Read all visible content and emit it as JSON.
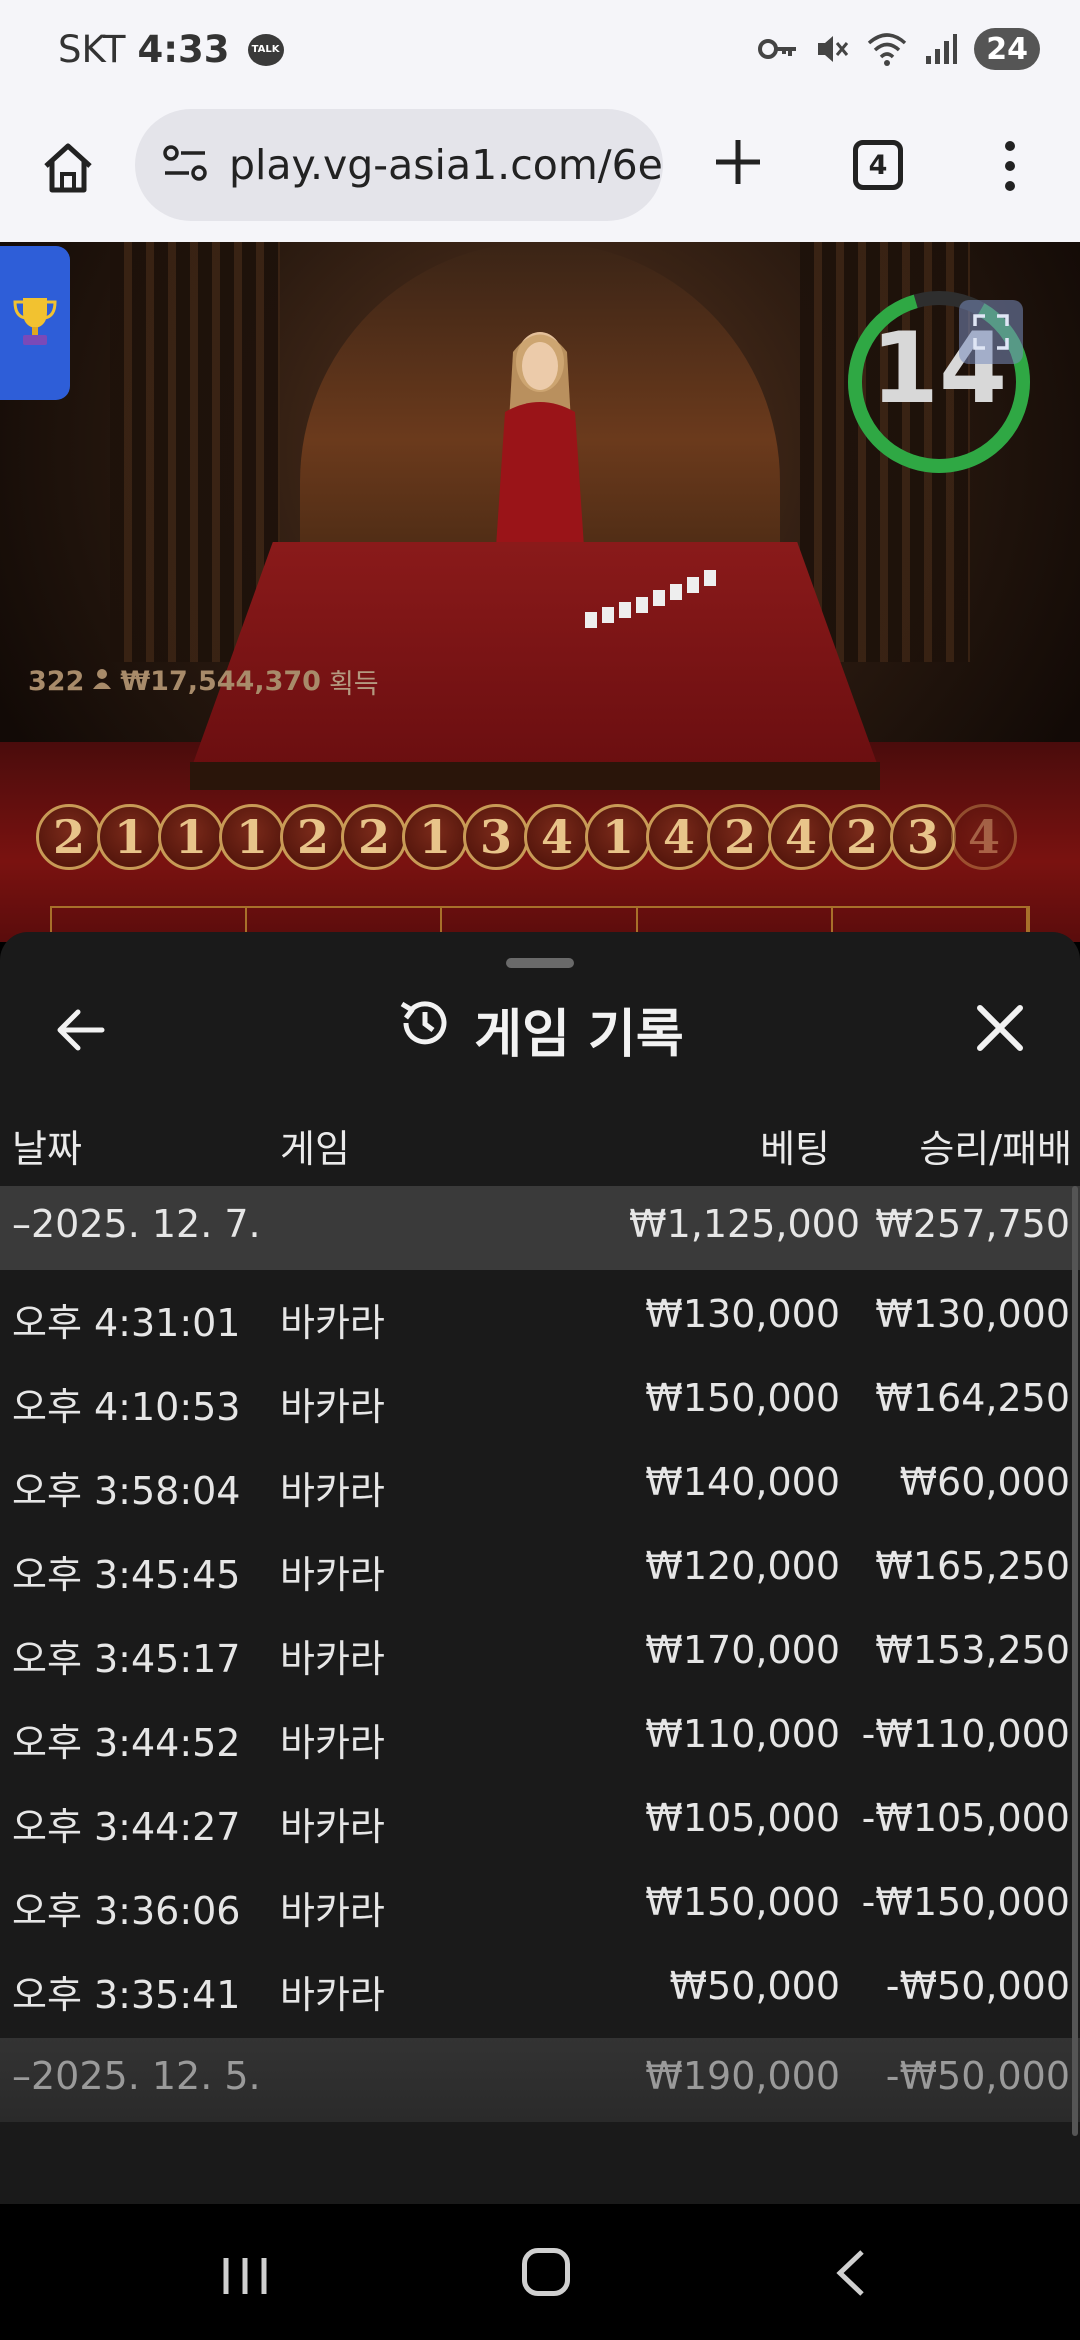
{
  "status_bar": {
    "carrier": "SKT",
    "time": "4:33",
    "talk_badge": "TALK",
    "battery": "24",
    "icons": [
      "key-icon",
      "mute-icon",
      "wifi-icon",
      "signal-icon"
    ]
  },
  "browser": {
    "url": "play.vg-asia1.com/6e",
    "tab_count": "4",
    "icons": [
      "home-icon",
      "site-settings-icon",
      "new-tab-icon",
      "tabs-icon",
      "menu-icon"
    ]
  },
  "game": {
    "timer": "14",
    "players": "322",
    "winnings": "₩17,544,370",
    "winnings_suffix": "획득",
    "road": [
      "2",
      "1",
      "1",
      "1",
      "2",
      "2",
      "1",
      "3",
      "4",
      "1",
      "4",
      "2",
      "4",
      "2",
      "3",
      "4"
    ],
    "accent_color": "#c89a56"
  },
  "history": {
    "title": "게임 기록",
    "columns": {
      "date": "날짜",
      "game": "게임",
      "bet": "베팅",
      "result": "승리/패배"
    },
    "groups": [
      {
        "date": "–2025. 12. 7.",
        "bet": "₩1,125,000",
        "result": "₩257,750",
        "rows": [
          {
            "time": "오후 4:31:01",
            "game": "바카라",
            "bet": "₩130,000",
            "result": "₩130,000"
          },
          {
            "time": "오후 4:10:53",
            "game": "바카라",
            "bet": "₩150,000",
            "result": "₩164,250"
          },
          {
            "time": "오후 3:58:04",
            "game": "바카라",
            "bet": "₩140,000",
            "result": "₩60,000"
          },
          {
            "time": "오후 3:45:45",
            "game": "바카라",
            "bet": "₩120,000",
            "result": "₩165,250"
          },
          {
            "time": "오후 3:45:17",
            "game": "바카라",
            "bet": "₩170,000",
            "result": "₩153,250"
          },
          {
            "time": "오후 3:44:52",
            "game": "바카라",
            "bet": "₩110,000",
            "result": "-₩110,000"
          },
          {
            "time": "오후 3:44:27",
            "game": "바카라",
            "bet": "₩105,000",
            "result": "-₩105,000"
          },
          {
            "time": "오후 3:36:06",
            "game": "바카라",
            "bet": "₩150,000",
            "result": "-₩150,000"
          },
          {
            "time": "오후 3:35:41",
            "game": "바카라",
            "bet": "₩50,000",
            "result": "-₩50,000"
          }
        ]
      },
      {
        "date": "–2025. 12. 5.",
        "bet": "₩190,000",
        "result": "-₩50,000",
        "rows": []
      }
    ]
  }
}
